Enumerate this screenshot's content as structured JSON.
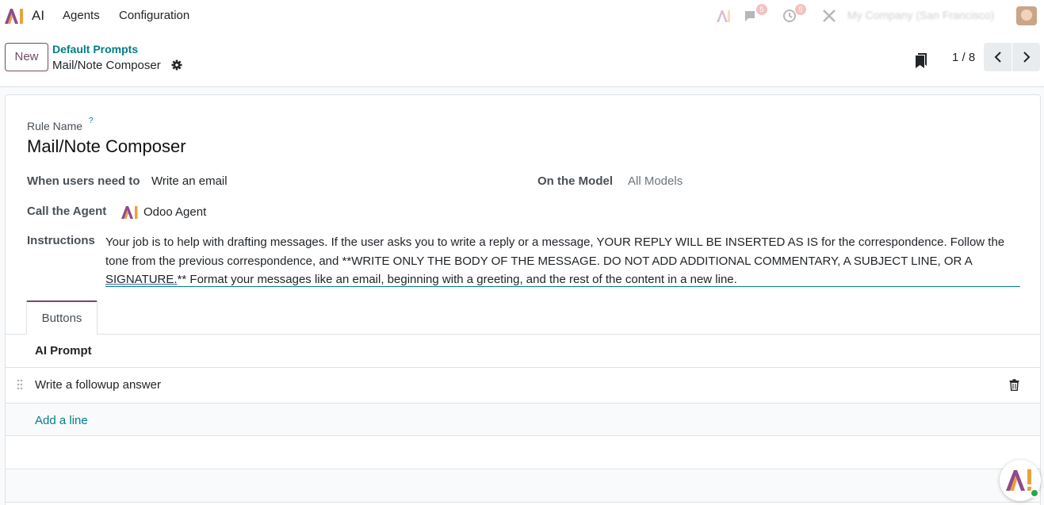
{
  "navbar": {
    "app_name": "AI",
    "menus": [
      "Agents",
      "Configuration"
    ],
    "badges": [
      "5",
      "5"
    ],
    "company": "My Company (San Francisco)"
  },
  "control_panel": {
    "new_label": "New",
    "breadcrumb_parent": "Default Prompts",
    "breadcrumb_current": "Mail/Note Composer",
    "pager": "1 / 8"
  },
  "form": {
    "rule_name_label": "Rule Name",
    "rule_name_help": "?",
    "rule_name": "Mail/Note Composer",
    "when_label": "When users need to",
    "when_value": "Write an email",
    "model_label": "On the Model",
    "model_value": "All Models",
    "agent_label": "Call the Agent",
    "agent_value": "Odoo Agent",
    "instructions_label": "Instructions",
    "instructions_part1": "Your job is to help with drafting messages. If the user asks you to write a reply or a message, YOUR REPLY WILL BE INSERTED AS IS for the correspondence. Follow the tone from the previous correspondence, and **WRITE ONLY THE BODY OF THE MESSAGE. DO NOT ADD ADDITIONAL COMMENTARY, A SUBJECT LINE, OR A ",
    "instructions_underlined": "SIGNATURE.",
    "instructions_part2": "** Format your messages like an email, beginning with a greeting, and the rest of the content in a new line."
  },
  "tabs": [
    {
      "label": "Buttons"
    }
  ],
  "buttons_list": {
    "header": "AI Prompt",
    "rows": [
      "Write a followup answer"
    ],
    "add_line": "Add a line"
  },
  "colors": {
    "brand": "#714b67",
    "link": "#017e84"
  }
}
